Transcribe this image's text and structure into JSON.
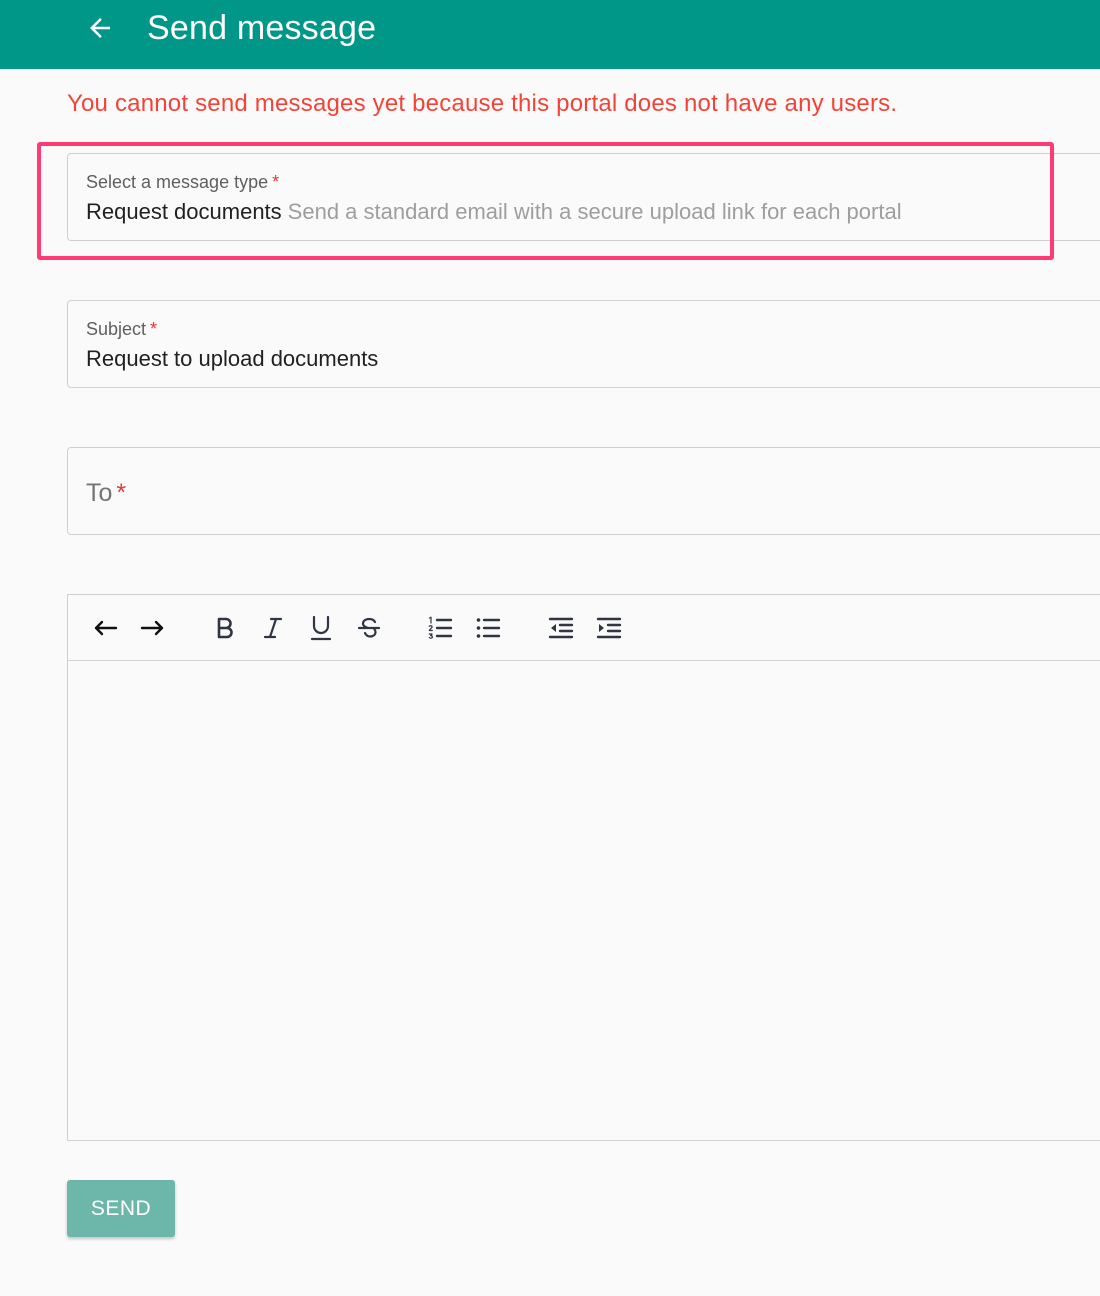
{
  "appbar": {
    "title": "Send message",
    "back_icon": "arrow-left-icon",
    "color": "#009688"
  },
  "error": {
    "text": "You cannot send messages yet because this portal does not have any users.",
    "color": "#f44336"
  },
  "message_type": {
    "label": "Select a message type",
    "required_mark": "*",
    "value": "Request documents",
    "hint": "Send a standard email with a secure upload link for each portal"
  },
  "subject": {
    "label": "Subject",
    "required_mark": "*",
    "value": "Request to upload documents"
  },
  "to": {
    "label": "To",
    "required_mark": "*"
  },
  "editor": {
    "toolbar": [
      {
        "name": "undo-icon"
      },
      {
        "name": "redo-icon"
      },
      {
        "name": "bold-icon"
      },
      {
        "name": "italic-icon"
      },
      {
        "name": "underline-icon"
      },
      {
        "name": "strikethrough-icon"
      },
      {
        "name": "ordered-list-icon"
      },
      {
        "name": "bullet-list-icon"
      },
      {
        "name": "outdent-icon"
      },
      {
        "name": "indent-icon"
      }
    ],
    "body": ""
  },
  "send": {
    "label": "SEND",
    "color": "#6db7aa"
  },
  "highlight_color": "#ff3b76"
}
